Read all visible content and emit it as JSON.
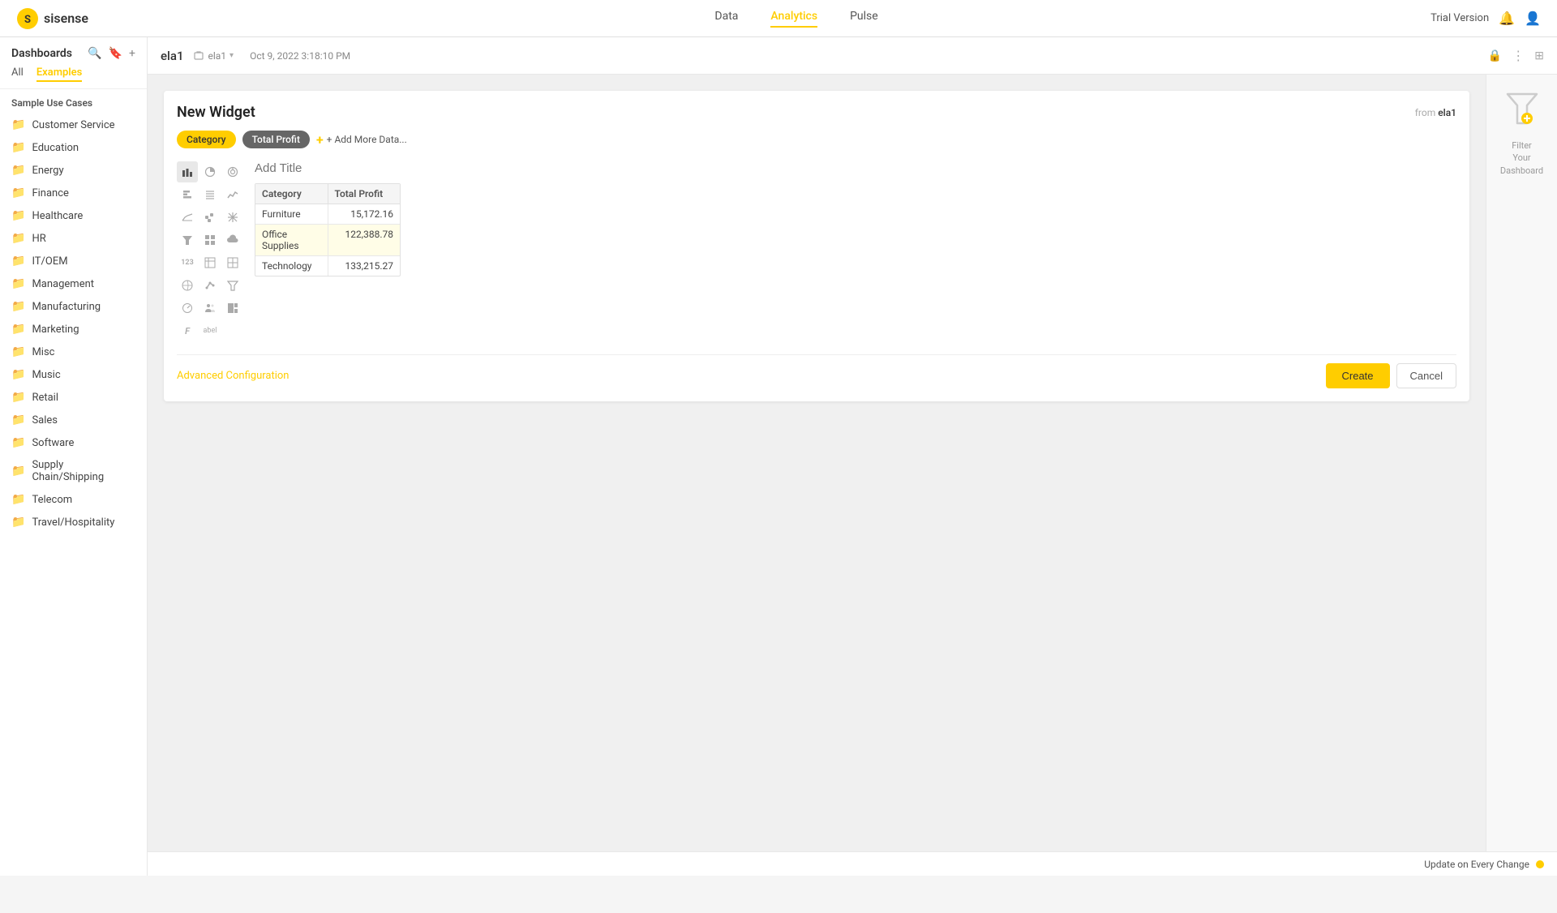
{
  "app": {
    "logo_text": "sisense"
  },
  "top_nav": {
    "data_label": "Data",
    "analytics_label": "Analytics",
    "pulse_label": "Pulse",
    "trial_label": "Trial Version",
    "active": "Analytics"
  },
  "sidebar": {
    "title": "Dashboards",
    "tab_all": "All",
    "tab_examples": "Examples",
    "section_title": "Sample Use Cases",
    "items": [
      "Customer Service",
      "Education",
      "Energy",
      "Finance",
      "Healthcare",
      "HR",
      "IT/OEM",
      "Management",
      "Manufacturing",
      "Marketing",
      "Misc",
      "Music",
      "Retail",
      "Sales",
      "Software",
      "Supply Chain/Shipping",
      "Telecom",
      "Travel/Hospitality"
    ]
  },
  "dashboard_toolbar": {
    "name": "ela1",
    "breadcrumb": "ela1",
    "timestamp": "Oct 9, 2022 3:18:10 PM"
  },
  "widget": {
    "title": "New Widget",
    "from_label": "from",
    "from_source": "ela1",
    "add_title_placeholder": "Add Title",
    "pill_category": "Category",
    "pill_total_profit": "Total Profit",
    "pill_add": "+ Add More Data...",
    "table": {
      "headers": [
        "Category",
        "Total Profit"
      ],
      "rows": [
        {
          "category": "Furniture",
          "value": "15,172.16"
        },
        {
          "category": "Office Supplies",
          "value": "122,388.78"
        },
        {
          "category": "Technology",
          "value": "133,215.27"
        }
      ]
    },
    "advanced_config": "Advanced Configuration",
    "create_btn": "Create",
    "cancel_btn": "Cancel"
  },
  "filter_panel": {
    "filter_label": "Filter",
    "your_label": "Your",
    "dashboard_label": "Dashboard"
  },
  "update_bar": {
    "label": "Update on Every Change"
  }
}
